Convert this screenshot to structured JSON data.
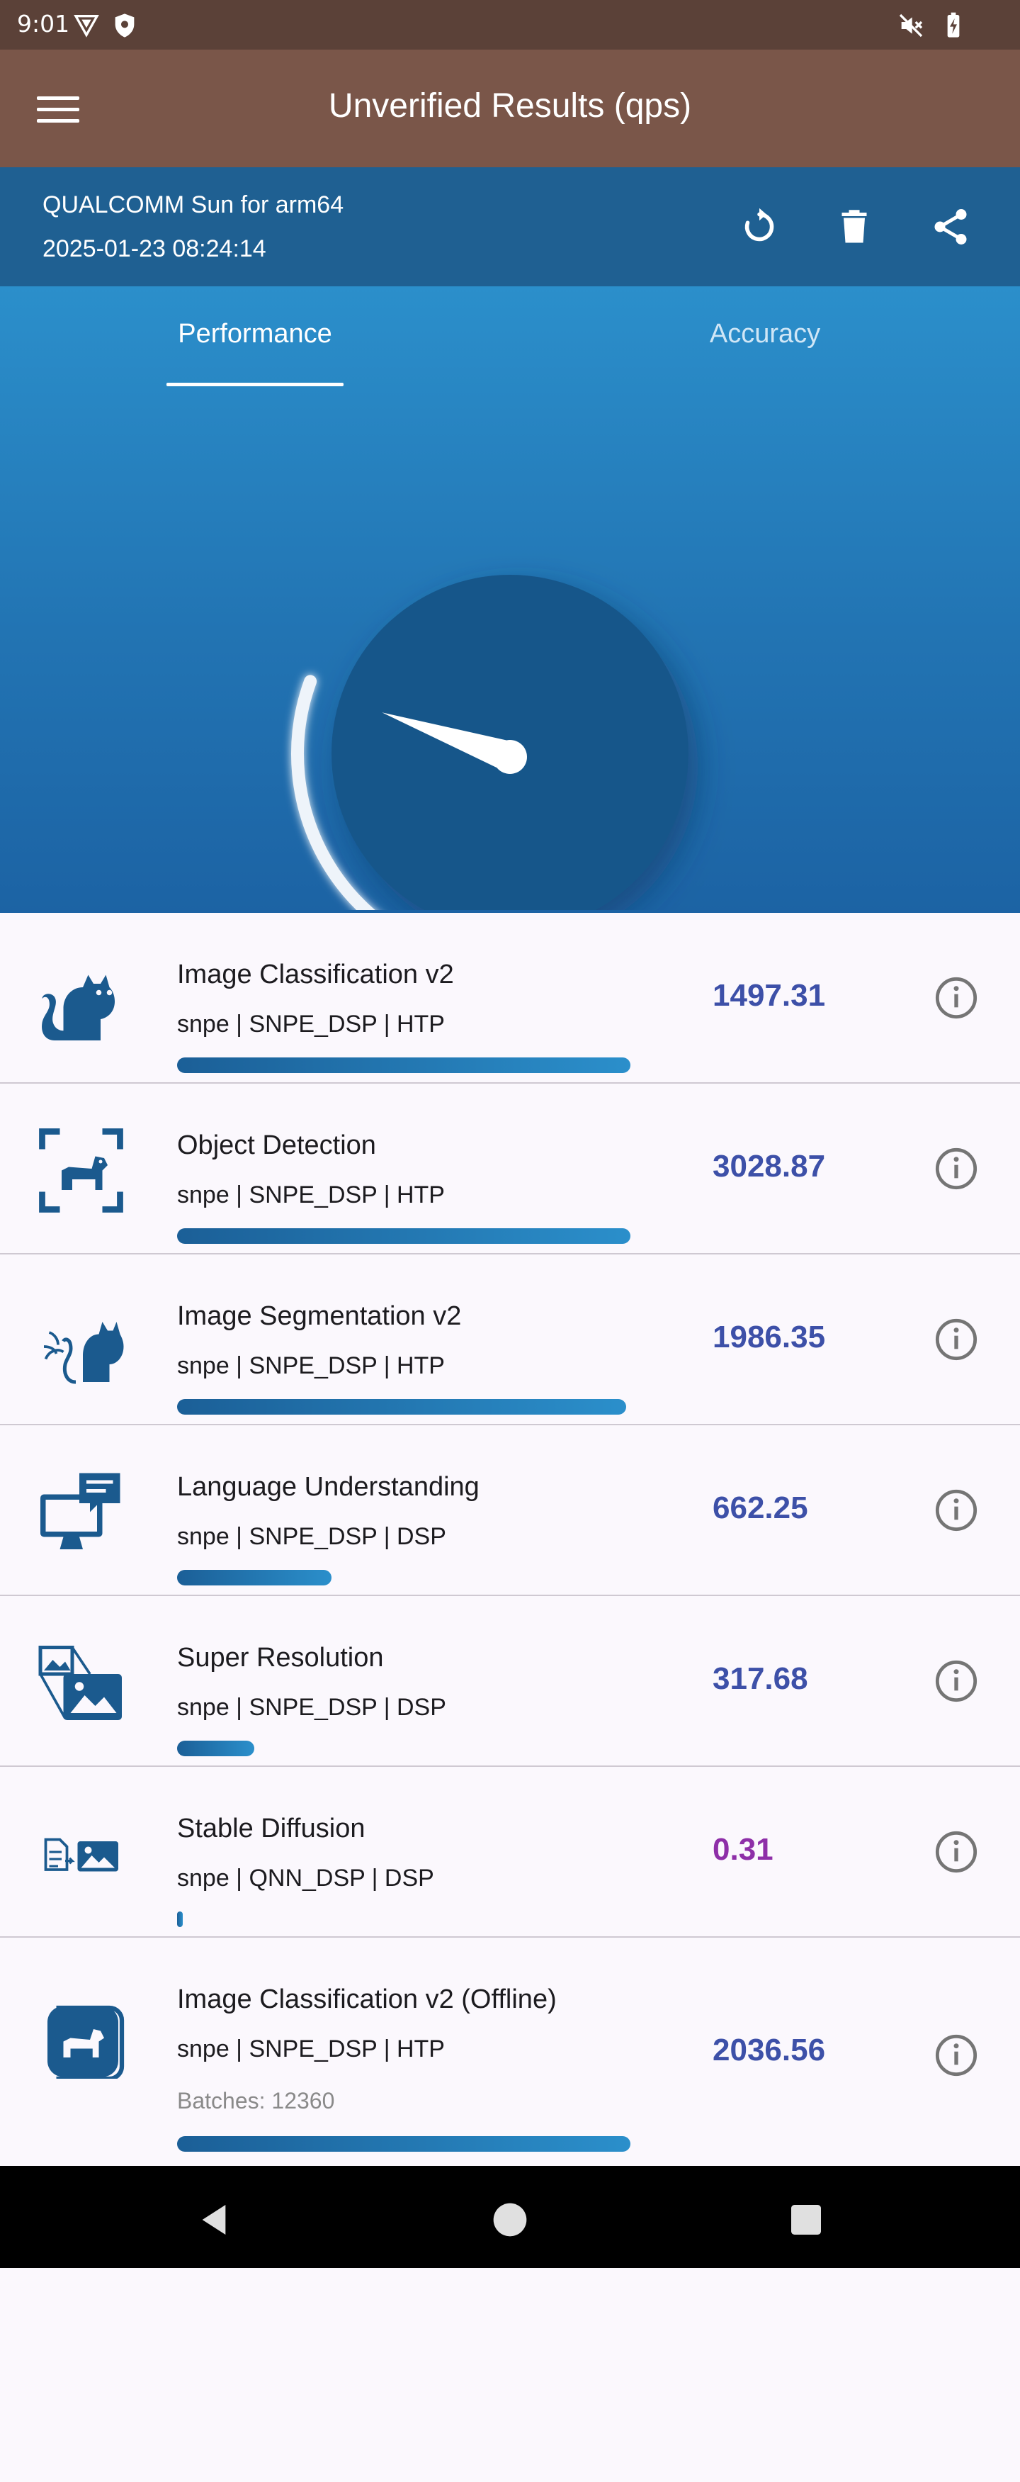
{
  "status_bar": {
    "time": "9:01"
  },
  "app_bar": {
    "title": "Unverified Results (qps)"
  },
  "info_bar": {
    "device": "QUALCOMM Sun for arm64",
    "date": "2025-01-23 08:24:14"
  },
  "tabs": [
    {
      "label": "Performance",
      "active": true
    },
    {
      "label": "Accuracy",
      "active": false
    }
  ],
  "gauge": {
    "level": 0.35
  },
  "results": [
    {
      "title": "Image Classification v2",
      "subtitle": "snpe | SNPE_DSP | HTP",
      "score": "1497.31",
      "bar_fraction": 1.0,
      "score_color": "#3d50a8",
      "icon": "cat-icon"
    },
    {
      "title": "Object Detection",
      "subtitle": "snpe | SNPE_DSP | HTP",
      "score": "3028.87",
      "bar_fraction": 1.0,
      "score_color": "#3d50a8",
      "icon": "dog-detection-icon"
    },
    {
      "title": "Image Segmentation v2",
      "subtitle": "snpe | SNPE_DSP | HTP",
      "score": "1986.35",
      "bar_fraction": 0.99,
      "score_color": "#3d50a8",
      "icon": "segmentation-cat-icon"
    },
    {
      "title": "Language Understanding",
      "subtitle": "snpe | SNPE_DSP | DSP",
      "score": "662.25",
      "bar_fraction": 0.34,
      "score_color": "#3d50a8",
      "icon": "monitor-chat-icon"
    },
    {
      "title": "Super Resolution",
      "subtitle": "snpe | SNPE_DSP | DSP",
      "score": "317.68",
      "bar_fraction": 0.17,
      "score_color": "#3d50a8",
      "icon": "image-upscale-icon"
    },
    {
      "title": "Stable Diffusion",
      "subtitle": "snpe | QNN_DSP | DSP",
      "score": "0.31",
      "bar_fraction": 0.01,
      "score_color": "#8e2fa8",
      "icon": "text-to-image-icon"
    },
    {
      "title": "Image Classification v2 (Offline)",
      "subtitle": "snpe | SNPE_DSP | HTP",
      "score": "2036.56",
      "batches": "Batches: 12360",
      "bar_fraction": 1.0,
      "score_color": "#3d50a8",
      "icon": "offline-dog-icon"
    }
  ]
}
